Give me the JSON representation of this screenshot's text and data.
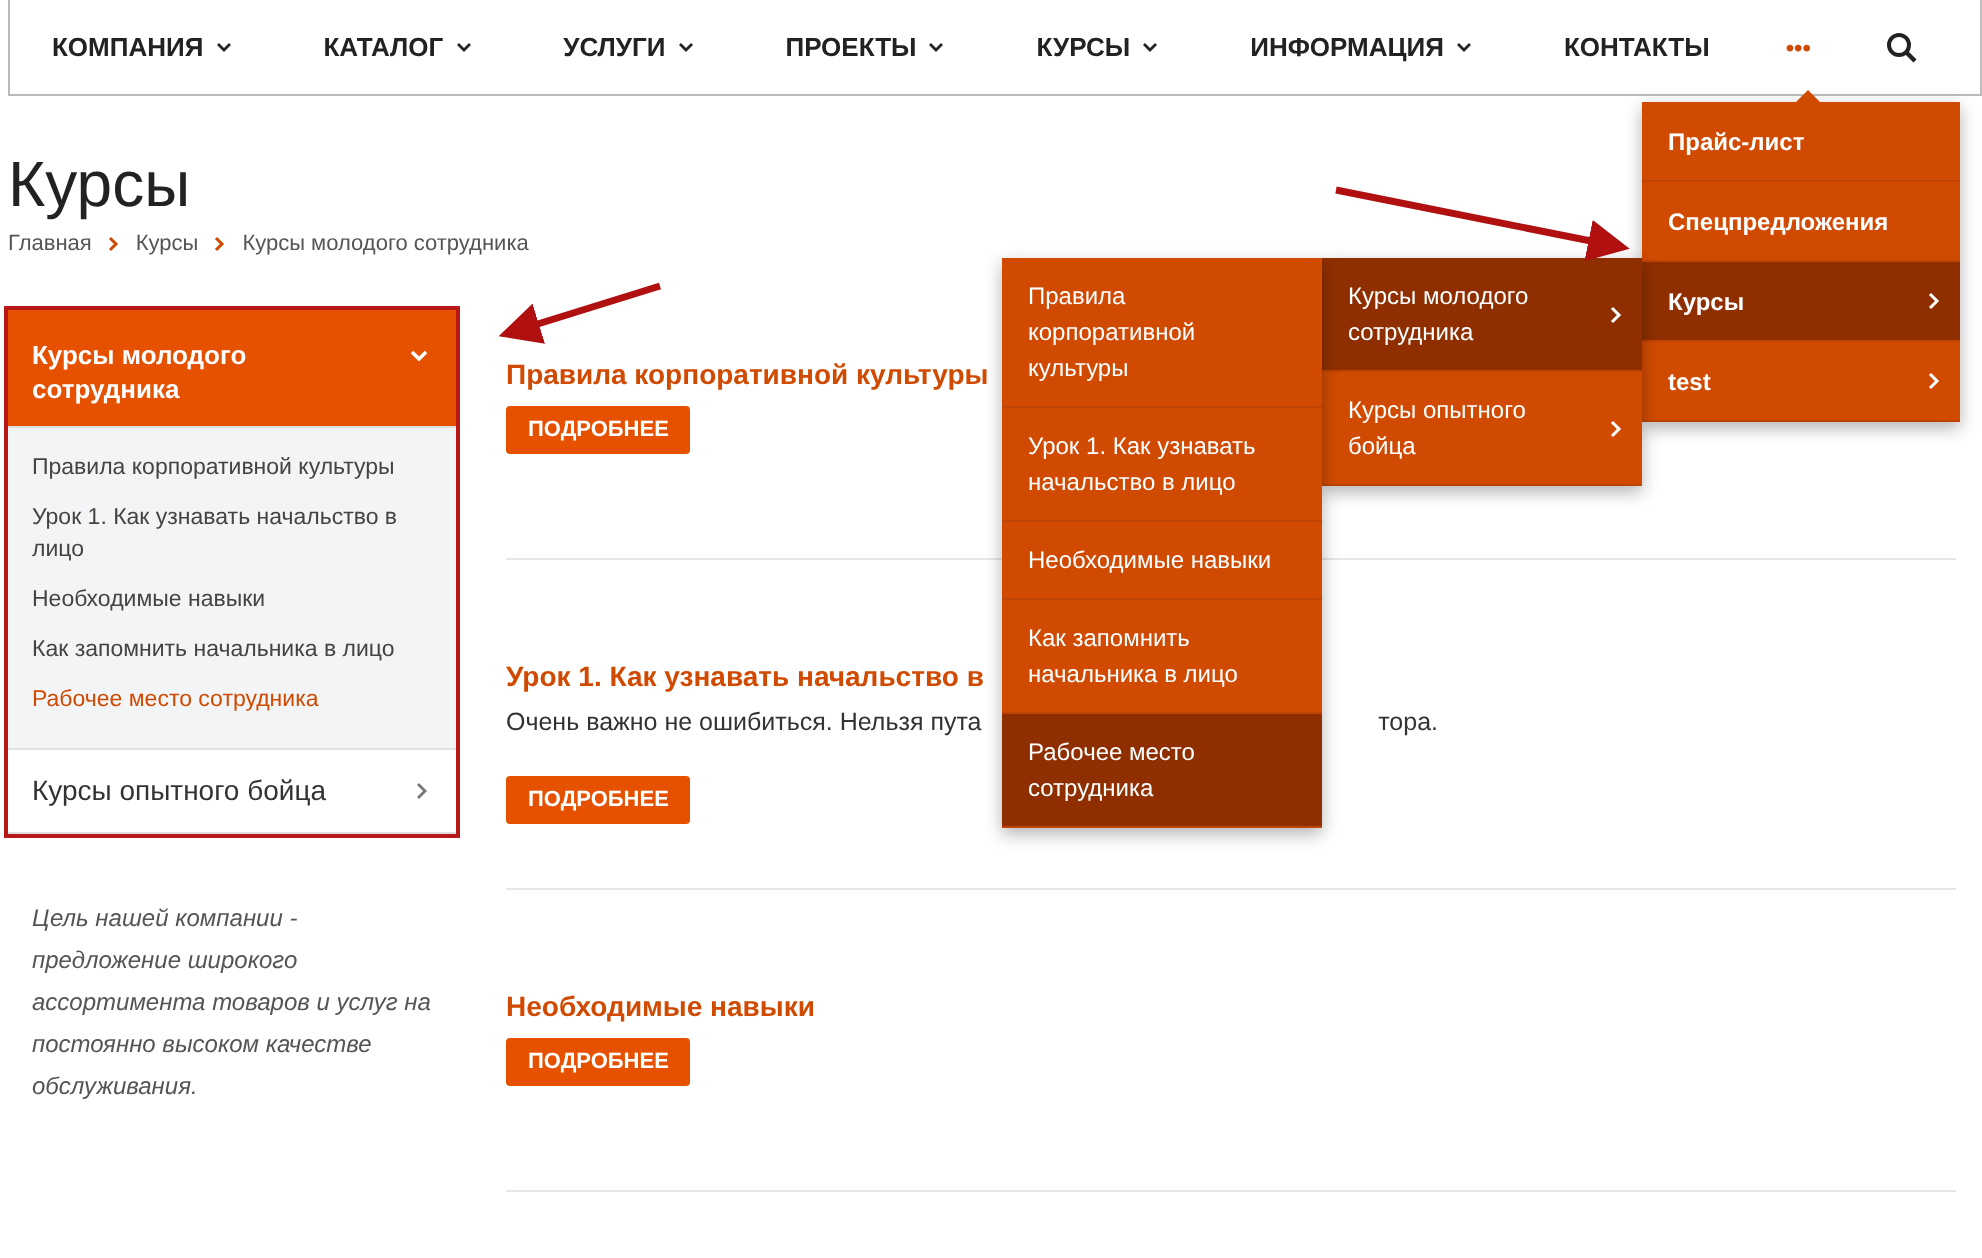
{
  "nav": {
    "items": [
      {
        "label": "КОМПАНИЯ",
        "caret": true
      },
      {
        "label": "КАТАЛОГ",
        "caret": true
      },
      {
        "label": "УСЛУГИ",
        "caret": true
      },
      {
        "label": "ПРОЕКТЫ",
        "caret": true
      },
      {
        "label": "КУРСЫ",
        "caret": true
      },
      {
        "label": "ИНФОРМАЦИЯ",
        "caret": true
      },
      {
        "label": "КОНТАКТЫ",
        "caret": false
      }
    ],
    "more": "•••"
  },
  "more_menu": [
    {
      "label": "Прайс-лист",
      "submenu": false,
      "selected": false
    },
    {
      "label": "Спецпредложения",
      "submenu": false,
      "selected": false
    },
    {
      "label": "Курсы",
      "submenu": true,
      "selected": true
    },
    {
      "label": "test",
      "submenu": true,
      "selected": false
    }
  ],
  "submenu": [
    {
      "label": "Курсы молодого сотрудника",
      "submenu": true,
      "selected": true
    },
    {
      "label": "Курсы опытного бойца",
      "submenu": true,
      "selected": false
    }
  ],
  "subsubmenu": [
    {
      "label": "Правила корпоративной культуры",
      "selected": false
    },
    {
      "label": "Урок 1. Как узнавать начальство в лицо",
      "selected": false
    },
    {
      "label": "Необходимые навыки",
      "selected": false
    },
    {
      "label": "Как запомнить начальника в лицо",
      "selected": false
    },
    {
      "label": "Рабочее место сотрудника",
      "selected": true
    }
  ],
  "page_title": "Курсы",
  "breadcrumb": [
    "Главная",
    "Курсы",
    "Курсы молодого сотрудника"
  ],
  "sidebar": {
    "sections": [
      {
        "title": "Курсы молодого сотрудника",
        "expanded": true,
        "children": [
          {
            "label": "Правила корпоративной культуры",
            "selected": false
          },
          {
            "label": "Урок 1. Как узнавать начальство в лицо",
            "selected": false
          },
          {
            "label": "Необходимые навыки",
            "selected": false
          },
          {
            "label": "Как запомнить начальника в лицо",
            "selected": false
          },
          {
            "label": "Рабочее место сотрудника",
            "selected": true
          }
        ]
      },
      {
        "title": "Курсы опытного бойца",
        "expanded": false
      }
    ],
    "motto": "Цель нашей компании - предложение широкого ассортимента товаров и услуг на постоянно высоком качестве обслуживания."
  },
  "articles": [
    {
      "title": "Правила корпоративной культуры",
      "button": "ПОДРОБНЕЕ"
    },
    {
      "title": "Урок 1. Как узнавать начальство в",
      "text_parts": [
        "Очень важно не ошибиться. Нельзя пута",
        "тора."
      ],
      "button": "ПОДРОБНЕЕ"
    },
    {
      "title": "Необходимые навыки",
      "button": "ПОДРОБНЕЕ"
    }
  ]
}
